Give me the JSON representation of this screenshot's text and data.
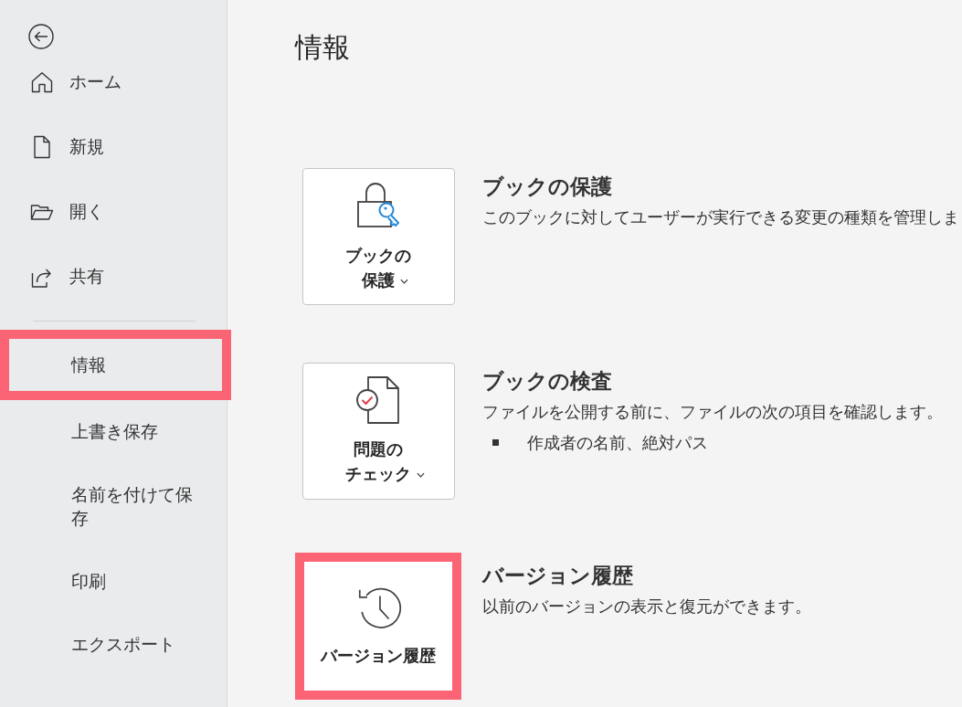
{
  "sidebar": {
    "top_items": [
      {
        "label": "ホーム"
      },
      {
        "label": "新規"
      },
      {
        "label": "開く"
      },
      {
        "label": "共有"
      }
    ],
    "bottom_items": [
      {
        "label": "情報",
        "highlighted": true
      },
      {
        "label": "上書き保存",
        "highlighted": false
      },
      {
        "label": "名前を付けて保存",
        "highlighted": false
      },
      {
        "label": "印刷",
        "highlighted": false
      },
      {
        "label": "エクスポート",
        "highlighted": false
      }
    ]
  },
  "main": {
    "title": "情報",
    "sections": [
      {
        "button_label": "ブックの保護",
        "has_menu": true,
        "highlighted": false,
        "title": "ブックの保護",
        "description": "このブックに対してユーザーが実行できる変更の種類を管理しま"
      },
      {
        "button_label": "問題のチェック",
        "has_menu": true,
        "highlighted": false,
        "title": "ブックの検査",
        "description": "ファイルを公開する前に、ファイルの次の項目を確認します。",
        "bullets": [
          "作成者の名前、絶対パス"
        ]
      },
      {
        "button_label": "バージョン履歴",
        "has_menu": false,
        "highlighted": true,
        "title": "バージョン履歴",
        "description": "以前のバージョンの表示と復元ができます。"
      }
    ]
  }
}
